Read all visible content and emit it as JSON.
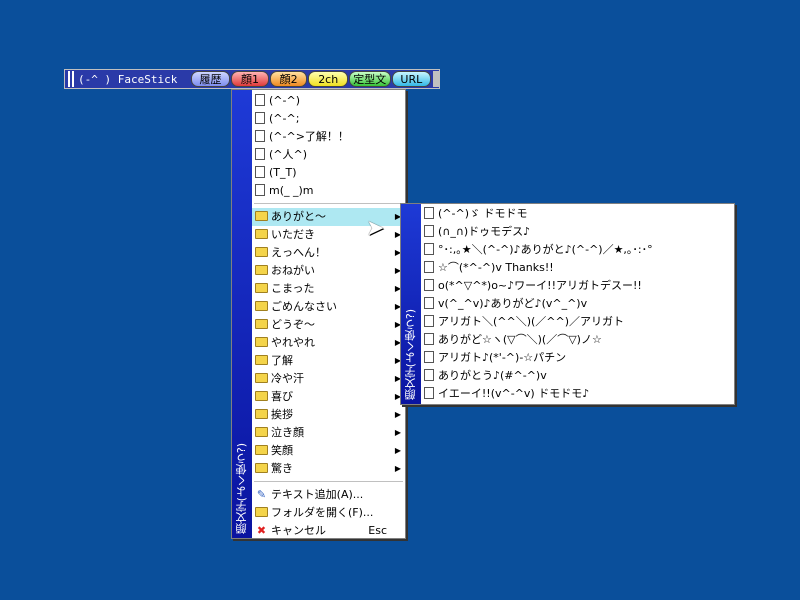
{
  "toolbar": {
    "title": "(-^ ) FaceStick",
    "tabs": [
      "履歴",
      "顔1",
      "顔2",
      "2ch",
      "定型文",
      "URL"
    ]
  },
  "main_menu": {
    "side_label": "顔文字(よく使う?)",
    "text_items": [
      "(^-^)",
      "(^-^;",
      "(^-^>了解！！",
      "(^人^)",
      "(T_T)",
      "m(_ _)m"
    ],
    "folders": [
      "ありがと〜",
      "いただき",
      "えっへん！",
      "おねがい",
      "こまった",
      "ごめんなさい",
      "どうぞ〜",
      "やれやれ",
      "了解",
      "冷や汗",
      "喜び",
      "挨拶",
      "泣き顔",
      "笑顔",
      "驚き"
    ],
    "actions": {
      "add_text": "テキスト追加(A)...",
      "open_folder": "フォルダを開く(F)...",
      "cancel": "キャンセル",
      "cancel_shortcut": "Esc"
    }
  },
  "sub_menu": {
    "side_label": "顔文字(よく使う?)",
    "items": [
      "(^-^)ゞ ドモドモ",
      "(∩_∩)ドゥモデス♪",
      "°･:,｡★＼(^-^)♪ありがと♪(^-^)／★,｡･:･°",
      "☆⌒(*^-^)v Thanks!!",
      "o(*^▽^*)o~♪ワーイ!!アリガトデスー!!",
      "v(^_^v)♪ありがど♪(v^_^)v",
      "アリガト＼(^^＼)(／^^)／アリガト",
      "ありがど☆ヽ(▽⌒＼)(／⌒▽)ノ☆",
      "アリガト♪(*'-^)-☆パチン",
      "ありがとう♪(#^-^)v",
      "イエーイ!!(v^-^v) ドモドモ♪"
    ]
  }
}
